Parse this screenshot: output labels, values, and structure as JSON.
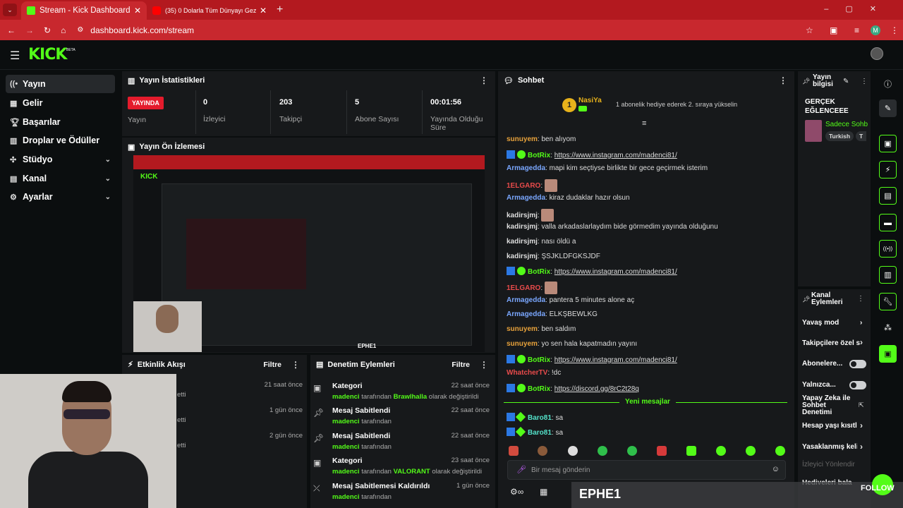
{
  "browser": {
    "tabs": [
      {
        "title": "Stream - Kick Dashboard"
      },
      {
        "title": "(35) 0 Dolarla Tüm Dünyayı Gez"
      }
    ],
    "url": "dashboard.kick.com/stream",
    "profile_initial": "M"
  },
  "brand": {
    "logo": "KICK",
    "beta": "BETA"
  },
  "sidebar": {
    "items": [
      {
        "label": "Yayın",
        "icon": "broadcast-icon"
      },
      {
        "label": "Gelir",
        "icon": "revenue-icon"
      },
      {
        "label": "Başarılar",
        "icon": "trophy-icon"
      },
      {
        "label": "Droplar ve Ödüller",
        "icon": "drops-icon"
      },
      {
        "label": "Stüdyo",
        "icon": "studio-icon"
      },
      {
        "label": "Kanal",
        "icon": "channel-icon"
      },
      {
        "label": "Ayarlar",
        "icon": "gear-icon"
      }
    ]
  },
  "stats": {
    "title": "Yayın İstatistikleri",
    "status_badge": "YAYINDA",
    "status_label": "Yayın",
    "viewers": "0",
    "viewers_label": "İzleyici",
    "followers": "203",
    "followers_label": "Takipçi",
    "subs": "5",
    "subs_label": "Abone Sayısı",
    "uptime": "00:01:56",
    "uptime_label": "Yayında Olduğu Süre"
  },
  "preview": {
    "title": "Yayın Ön İzlemesi",
    "overlay_name": "EPHE1"
  },
  "activity": {
    "title": "Etkinlik Akışı",
    "filter": "Filtre",
    "items": [
      {
        "text": "etti",
        "ago": "21 saat önce"
      },
      {
        "text": "etti",
        "ago": "1 gün önce"
      },
      {
        "text": "etti",
        "ago": "2 gün önce"
      }
    ]
  },
  "moderation": {
    "title": "Denetim Eylemleri",
    "filter": "Filtre",
    "items": [
      {
        "title": "Kategori",
        "user": "madenci",
        "mid": "tarafından",
        "target": "Brawlhalla",
        "tail": "olarak değiştirildi",
        "ago": "22 saat önce",
        "icon": "category-icon"
      },
      {
        "title": "Mesaj Sabitlendi",
        "user": "madenci",
        "mid": "tarafından",
        "target": "",
        "tail": "",
        "ago": "22 saat önce",
        "icon": "pin-icon"
      },
      {
        "title": "Mesaj Sabitlendi",
        "user": "madenci",
        "mid": "tarafından",
        "target": "",
        "tail": "",
        "ago": "22 saat önce",
        "icon": "pin-icon"
      },
      {
        "title": "Kategori",
        "user": "madenci",
        "mid": "tarafından",
        "target": "VALORANT",
        "tail": "olarak değiştirildi",
        "ago": "23 saat önce",
        "icon": "category-icon"
      },
      {
        "title": "Mesaj Sabitlemesi Kaldırıldı",
        "user": "madenci",
        "mid": "tarafından",
        "target": "",
        "tail": "",
        "ago": "1 gün önce",
        "icon": "unpin-icon"
      }
    ]
  },
  "chat": {
    "title": "Sohbet",
    "pinned_user": "NasiYa",
    "pinned_badge": "1",
    "pinned_msg": "1 abonelik hediye ederek 2. sıraya yükselin",
    "new_messages": "Yeni mesajlar",
    "input_placeholder": "Bir mesaj gönderin",
    "messages": [
      {
        "user": "sunuyem",
        "color": "#e8a23b",
        "text": "ben alıyom",
        "link": false
      },
      {
        "user": "BotRix",
        "color": "#53fc18",
        "text": "https://www.instagram.com/madenci81/",
        "link": true
      },
      {
        "user": "Armagedda",
        "color": "#7aa7ff",
        "text": "mapi kim seçtiyse birlikte bir gece geçirmek isterim",
        "link": false
      },
      {
        "user": "1ELGARO",
        "color": "#e84b4b",
        "text": "",
        "link": false
      },
      {
        "user": "Armagedda",
        "color": "#7aa7ff",
        "text": "kiraz dudaklar hazır olsun",
        "link": false
      },
      {
        "user": "kadirsjmj",
        "color": "#ddd",
        "text": "",
        "link": false
      },
      {
        "user": "kadirsjmj",
        "color": "#ddd",
        "text": "valla arkadaslarlaydım bide görmedim yayında olduğunu",
        "link": false
      },
      {
        "user": "kadirsjmj",
        "color": "#ddd",
        "text": "nası öldü a",
        "link": false
      },
      {
        "user": "kadirsjmj",
        "color": "#ddd",
        "text": "ŞSJKLDFGKSJDF",
        "link": false
      },
      {
        "user": "BotRix",
        "color": "#53fc18",
        "text": "https://www.instagram.com/madenci81/",
        "link": true
      },
      {
        "user": "1ELGARO",
        "color": "#e84b4b",
        "text": "",
        "link": false
      },
      {
        "user": "Armagedda",
        "color": "#7aa7ff",
        "text": "pantera 5 minutes alone aç",
        "link": false
      },
      {
        "user": "Armagedda",
        "color": "#7aa7ff",
        "text": "ELKŞBEWLKG",
        "link": false
      },
      {
        "user": "sunuyem",
        "color": "#e8a23b",
        "text": "ben saldım",
        "link": false
      },
      {
        "user": "sunuyem",
        "color": "#e8a23b",
        "text": "yo sen hala kapatmadın yayını",
        "link": false
      },
      {
        "user": "BotRix",
        "color": "#53fc18",
        "text": "https://www.instagram.com/madenci81/",
        "link": true
      },
      {
        "user": "WhatcherTV",
        "color": "#e84b4b",
        "text": "!dc",
        "link": false
      },
      {
        "user": "BotRix",
        "color": "#53fc18",
        "text": "https://discord.gg/8rC2t28q",
        "link": true
      }
    ],
    "after": [
      {
        "user": "Baro81",
        "color": "#53e0c8",
        "text": "sa"
      },
      {
        "user": "Baro81",
        "color": "#53e0c8",
        "text": "sa"
      }
    ]
  },
  "info": {
    "title": "Yayın bilgisi",
    "stream_title": "GERÇEK EĞLENCEEE",
    "category": "Sadece Sohb",
    "tag": "Turkish",
    "tag2": "T"
  },
  "actions": {
    "title": "Kanal Eylemleri",
    "items": [
      "Yavaş mod",
      "Takipçilere özel s",
      "Abonelere...",
      "Yalnızca...",
      "Yapay Zeka ile Sohbet Denetimi",
      "Hesap yaşı kısıtla",
      "Yasaklanmış keli",
      "İzleyici Yönlendir",
      "Hediyeleri bala"
    ]
  },
  "overlay": {
    "name": "EPHE1",
    "follow": "FOLLOW"
  },
  "colors": {
    "accent": "#53fc18",
    "browser": "#c8282e",
    "panel": "#17191b"
  }
}
